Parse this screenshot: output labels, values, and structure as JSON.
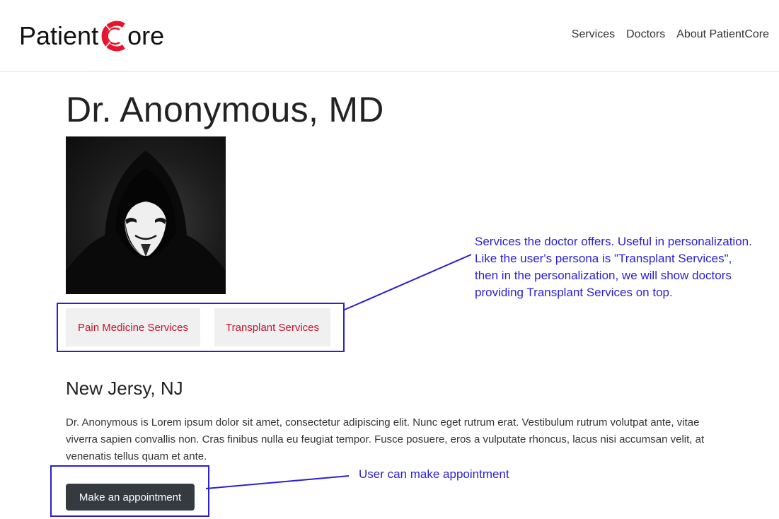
{
  "brand": {
    "part1": "Patient",
    "part2": "ore",
    "accent_color": "#e8142d"
  },
  "nav": {
    "items": [
      {
        "label": "Services"
      },
      {
        "label": "Doctors"
      },
      {
        "label": "About PatientCore"
      }
    ]
  },
  "doctor": {
    "name": "Dr. Anonymous, MD",
    "photo_icon": "hooded-mask-portrait",
    "services": [
      {
        "label": "Pain Medicine Services"
      },
      {
        "label": "Transplant Services"
      }
    ],
    "location": "New Jersy, NJ",
    "bio": "Dr. Anonymous is Lorem ipsum dolor sit amet, consectetur adipiscing elit. Nunc eget rutrum erat. Vestibulum rutrum volutpat ante, vitae viverra sapien convallis non. Cras finibus nulla eu feugiat tempor. Fusce posuere, eros a vulputate rhoncus, lacus nisi accumsan velit, at venenatis tellus quam et ante.",
    "appointment_button": "Make an appointment"
  },
  "annotations": {
    "color": "#2a1fd6",
    "services_note": [
      "Services the doctor offers. Useful in personalization.",
      "Like the user's persona is \"Transplant Services\",",
      "then in the personalization, we will show doctors",
      "providing Transplant Services on top."
    ],
    "appointment_note": "User can make appointment"
  },
  "colors": {
    "service_text": "#c8102e",
    "button_bg": "#343a40"
  }
}
